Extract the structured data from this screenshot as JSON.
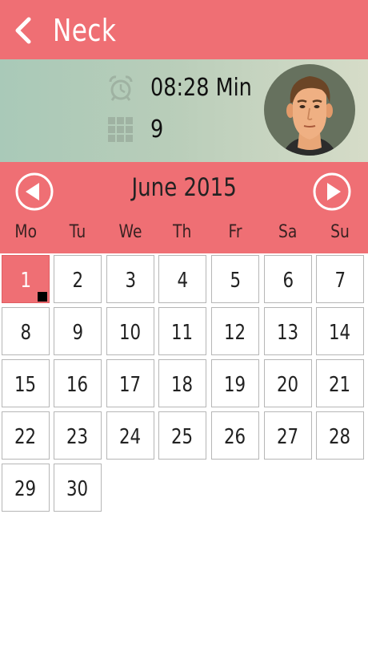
{
  "header": {
    "title": "Neck"
  },
  "stats": {
    "time_value": "08:28 Min",
    "exercises_value": "9"
  },
  "calendar": {
    "month_label": "June 2015",
    "weekdays": [
      "Mo",
      "Tu",
      "We",
      "Th",
      "Fr",
      "Sa",
      "Su"
    ],
    "start_offset": 0,
    "days": [
      "1",
      "2",
      "3",
      "4",
      "5",
      "6",
      "7",
      "8",
      "9",
      "10",
      "11",
      "12",
      "13",
      "14",
      "15",
      "16",
      "17",
      "18",
      "19",
      "20",
      "21",
      "22",
      "23",
      "24",
      "25",
      "26",
      "27",
      "28",
      "29",
      "30"
    ],
    "today": "1",
    "marked_days": [
      "1"
    ]
  },
  "colors": {
    "accent": "#ef6f74",
    "stats_gradient_start": "#a9c9b8",
    "stats_gradient_end": "#d6dcc8"
  },
  "icons": {
    "back": "chevron-left-icon",
    "time": "alarm-clock-icon",
    "count": "grid-icon",
    "prev": "circle-arrow-left-icon",
    "next": "circle-arrow-right-icon"
  }
}
